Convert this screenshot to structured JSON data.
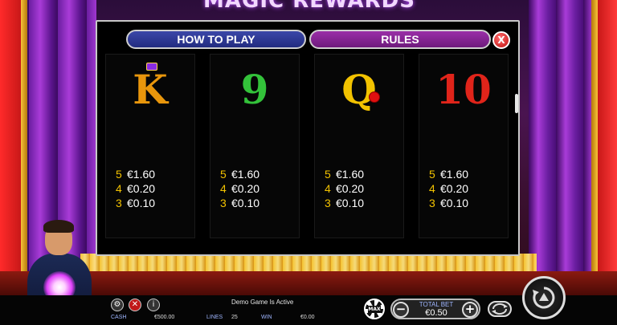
{
  "game": {
    "logo_text": "MAGIC REWARDS"
  },
  "dialog": {
    "tabs": [
      {
        "label": "HOW TO PLAY"
      },
      {
        "label": "RULES"
      }
    ],
    "close_label": "X",
    "cards": [
      {
        "symbol": "K",
        "symbol_color": "#e8960c",
        "decoration": "crown-icon",
        "pays": [
          {
            "count": "5",
            "value": "€1.60"
          },
          {
            "count": "4",
            "value": "€0.20"
          },
          {
            "count": "3",
            "value": "€0.10"
          }
        ]
      },
      {
        "symbol": "9",
        "symbol_color": "#33c23a",
        "decoration": "",
        "pays": [
          {
            "count": "5",
            "value": "€1.60"
          },
          {
            "count": "4",
            "value": "€0.20"
          },
          {
            "count": "3",
            "value": "€0.10"
          }
        ]
      },
      {
        "symbol": "Q",
        "symbol_color": "#f2c200",
        "decoration": "rose-icon",
        "pays": [
          {
            "count": "5",
            "value": "€1.60"
          },
          {
            "count": "4",
            "value": "€0.20"
          },
          {
            "count": "3",
            "value": "€0.10"
          }
        ]
      },
      {
        "symbol": "10",
        "symbol_color": "#e0241a",
        "decoration": "",
        "pays": [
          {
            "count": "5",
            "value": "€1.60"
          },
          {
            "count": "4",
            "value": "€0.20"
          },
          {
            "count": "3",
            "value": "€0.10"
          }
        ]
      }
    ]
  },
  "bottom_bar": {
    "status_text": "Demo Game Is Active",
    "cash_label": "CASH",
    "cash_value": "€500.00",
    "lines_label": "LINES",
    "lines_value": "25",
    "win_label": "WIN",
    "win_value": "€0.00",
    "max_label": "MAX",
    "total_bet_label": "TOTAL BET",
    "total_bet_value": "€0.50",
    "minus_label": "−",
    "plus_label": "+"
  },
  "icons": {
    "settings": "gear-icon",
    "sound": "sound-off-icon",
    "info": "info-icon",
    "autoplay": "autoplay-icon",
    "spin": "spin-icon"
  },
  "colors": {
    "tab_how": "#2b3590",
    "tab_rules": "#7e2290",
    "close": "#d01818",
    "count_color": "#f2c200"
  }
}
